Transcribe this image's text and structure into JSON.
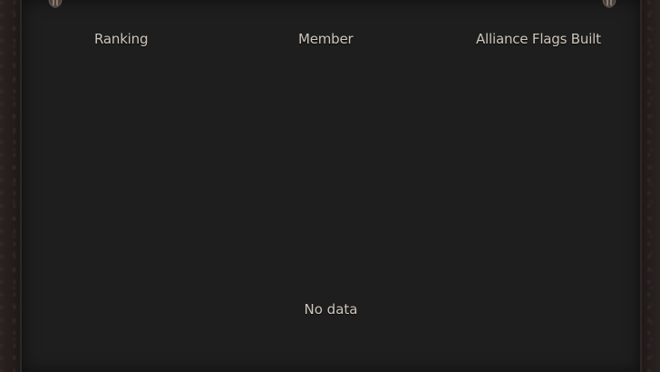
{
  "table": {
    "columns": {
      "ranking": "Ranking",
      "member": "Member",
      "flags": "Alliance Flags Built"
    },
    "empty_message": "No data",
    "rows": []
  },
  "theme": {
    "panel_bg": "#1e1e1e",
    "text": "#cfc6bb",
    "border": "#2c2725"
  },
  "icons": {
    "left_ornament": "frame-ornament-icon",
    "right_ornament": "frame-ornament-icon"
  }
}
